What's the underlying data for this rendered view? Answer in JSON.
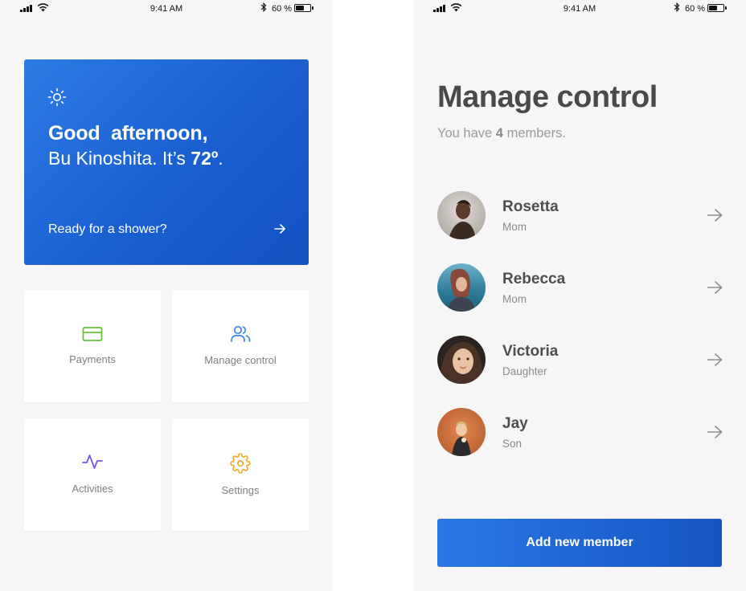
{
  "status_bar": {
    "time": "9:41 AM",
    "battery_label": "60 %",
    "battery_level": 0.6
  },
  "home": {
    "greeting_bold": "Good",
    "greeting_rest": "afternoon",
    "greeting_comma": ",",
    "greeting_name": "Bu Kinoshita. It’s ",
    "temperature": "72º",
    "greeting_end": ".",
    "cta": "Ready for a shower?",
    "tiles": [
      {
        "label": "Payments",
        "icon": "credit-card-icon",
        "color": "#67c23a"
      },
      {
        "label": "Manage control",
        "icon": "users-icon",
        "color": "#3a86e8"
      },
      {
        "label": "Activities",
        "icon": "activity-icon",
        "color": "#6b5ce7"
      },
      {
        "label": "Settings",
        "icon": "gear-icon",
        "color": "#f5a623"
      }
    ]
  },
  "manage": {
    "title": "Manage control",
    "subtitle_pre": "You have ",
    "count": "4",
    "subtitle_post": " members.",
    "members": [
      {
        "name": "Rosetta",
        "role": "Mom"
      },
      {
        "name": "Rebecca",
        "role": "Mom"
      },
      {
        "name": "Victoria",
        "role": "Daughter"
      },
      {
        "name": "Jay",
        "role": "Son"
      }
    ],
    "add_button": "Add new member"
  },
  "colors": {
    "accent": "#1e63d1",
    "background": "#f6f6f6"
  }
}
